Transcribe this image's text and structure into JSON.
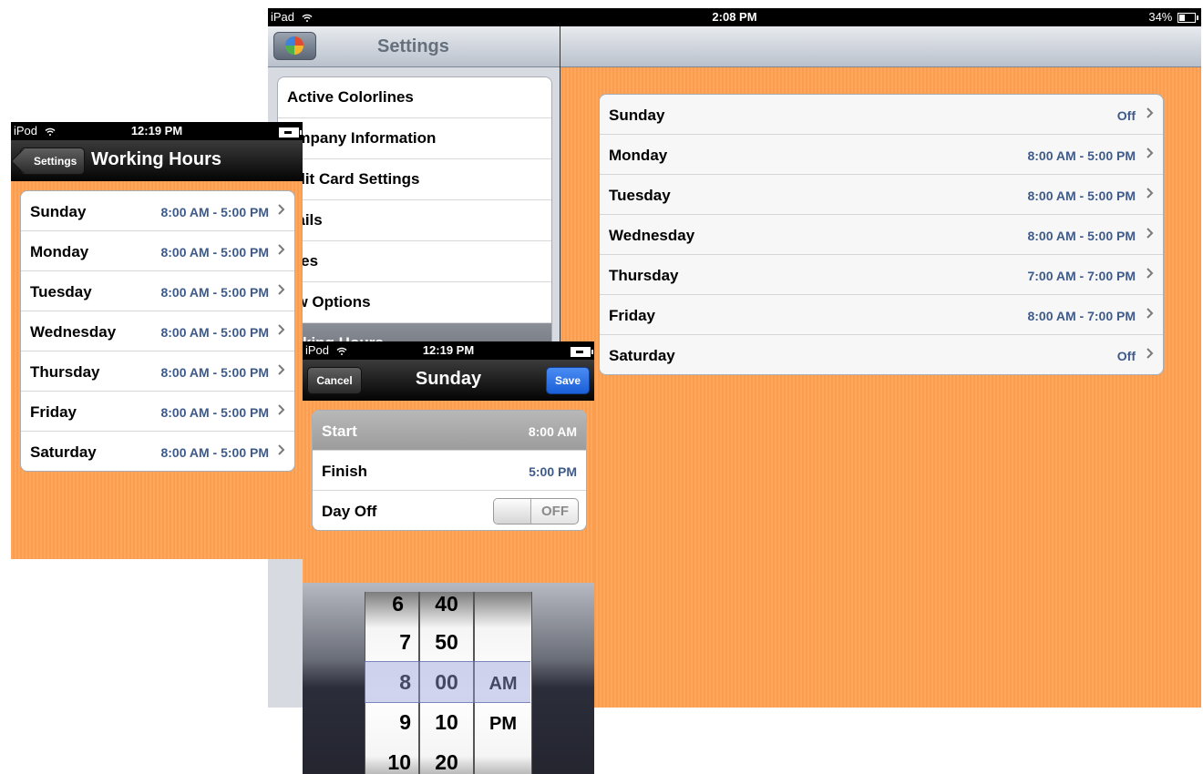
{
  "colors": {
    "background": "#ffa050",
    "detail_value": "#3d5a8a",
    "save_button": "#2a6ee0"
  },
  "ipad": {
    "status": {
      "device": "iPad",
      "time": "2:08 PM",
      "battery": "34%"
    },
    "master": {
      "title": "Settings",
      "logo_icon": "colorlines-logo-icon",
      "items": [
        {
          "label": "Active Colorlines"
        },
        {
          "label": "ompany Information"
        },
        {
          "label": "edit Card Settings"
        },
        {
          "label": "nails"
        },
        {
          "label": "ates"
        },
        {
          "label": "ew Options"
        },
        {
          "label": "orking Hours",
          "selected": true
        }
      ]
    },
    "detail": {
      "rows": [
        {
          "day": "Sunday",
          "value": "Off"
        },
        {
          "day": "Monday",
          "value": "8:00 AM - 5:00 PM"
        },
        {
          "day": "Tuesday",
          "value": "8:00 AM - 5:00 PM"
        },
        {
          "day": "Wednesday",
          "value": "8:00 AM - 5:00 PM"
        },
        {
          "day": "Thursday",
          "value": "7:00 AM - 7:00 PM"
        },
        {
          "day": "Friday",
          "value": "8:00 AM - 7:00 PM"
        },
        {
          "day": "Saturday",
          "value": "Off"
        }
      ]
    }
  },
  "ipod_hours": {
    "status": {
      "device": "iPod",
      "time": "12:19 PM"
    },
    "back_label": "Settings",
    "title": "Working Hours",
    "rows": [
      {
        "day": "Sunday",
        "value": "8:00 AM - 5:00 PM"
      },
      {
        "day": "Monday",
        "value": "8:00 AM - 5:00 PM"
      },
      {
        "day": "Tuesday",
        "value": "8:00 AM - 5:00 PM"
      },
      {
        "day": "Wednesday",
        "value": "8:00 AM - 5:00 PM"
      },
      {
        "day": "Thursday",
        "value": "8:00 AM - 5:00 PM"
      },
      {
        "day": "Friday",
        "value": "8:00 AM - 5:00 PM"
      },
      {
        "day": "Saturday",
        "value": "8:00 AM - 5:00 PM"
      }
    ]
  },
  "ipod_edit": {
    "status": {
      "device": "iPod",
      "time": "12:19 PM"
    },
    "cancel_label": "Cancel",
    "title": "Sunday",
    "save_label": "Save",
    "start": {
      "label": "Start",
      "value": "8:00 AM"
    },
    "finish": {
      "label": "Finish",
      "value": "5:00 PM"
    },
    "day_off": {
      "label": "Day Off",
      "toggle_text": "OFF"
    },
    "picker": {
      "hours": [
        "6",
        "7",
        "8",
        "9",
        "10"
      ],
      "minutes": [
        "40",
        "50",
        "00",
        "10",
        "20"
      ],
      "ampm": [
        "AM",
        "PM"
      ]
    }
  }
}
